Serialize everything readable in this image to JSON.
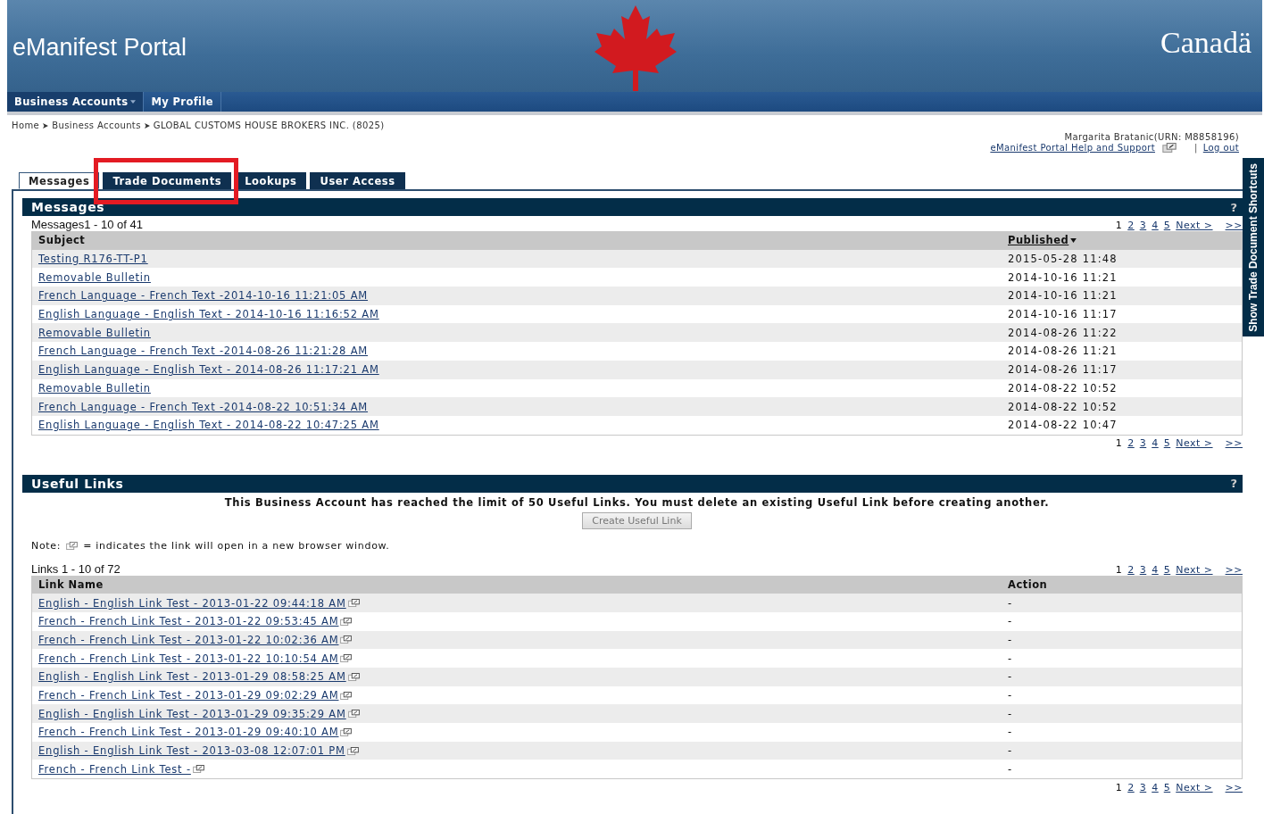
{
  "header": {
    "title": "eManifest Portal",
    "wordmark": "Canadä"
  },
  "nav": [
    {
      "label": "Business Accounts",
      "selected": true,
      "dropdown": true
    },
    {
      "label": "My Profile",
      "selected": false,
      "dropdown": false
    }
  ],
  "breadcrumb": [
    "Home",
    "Business Accounts",
    "GLOBAL CUSTOMS HOUSE BROKERS INC. (8025)"
  ],
  "user": {
    "name": "Margarita Bratanic(URN: M8858196)",
    "help_link": "eManifest Portal Help and Support",
    "separator": "|",
    "logout": "Log out"
  },
  "tabs": [
    {
      "label": "Messages",
      "selected": true,
      "highlighted": false
    },
    {
      "label": "Trade Documents",
      "selected": false,
      "highlighted": true
    },
    {
      "label": "Lookups",
      "selected": false,
      "highlighted": false
    },
    {
      "label": "User Access",
      "selected": false,
      "highlighted": false
    }
  ],
  "side_tab": "Show Trade Document Shortcuts",
  "messages": {
    "title": "Messages",
    "help": "?",
    "count": "Messages1 - 10 of 41",
    "pager_top": {
      "pages": [
        {
          "label": "1",
          "selected": true
        },
        {
          "label": "2",
          "selected": false
        },
        {
          "label": "3",
          "selected": false
        },
        {
          "label": "4",
          "selected": false
        },
        {
          "label": "5",
          "selected": false
        }
      ],
      "next": "Next >",
      "last": ">>"
    },
    "columns": [
      {
        "label": "Subject",
        "sorted": false
      },
      {
        "label": "Published",
        "sorted": true
      }
    ],
    "rows": [
      {
        "subject": "Testing R176-TT-P1",
        "published": "2015-05-28 11:48"
      },
      {
        "subject": "Removable Bulletin",
        "published": "2014-10-16 11:21"
      },
      {
        "subject": "French Language - French Text -2014-10-16 11:21:05 AM",
        "published": "2014-10-16 11:21"
      },
      {
        "subject": "English Language - English Text - 2014-10-16 11:16:52 AM",
        "published": "2014-10-16 11:17"
      },
      {
        "subject": "Removable Bulletin",
        "published": "2014-08-26 11:22"
      },
      {
        "subject": "French Language - French Text -2014-08-26 11:21:28 AM",
        "published": "2014-08-26 11:21"
      },
      {
        "subject": "English Language - English Text - 2014-08-26 11:17:21 AM",
        "published": "2014-08-26 11:17"
      },
      {
        "subject": "Removable Bulletin",
        "published": "2014-08-22 10:52"
      },
      {
        "subject": "French Language - French Text -2014-08-22 10:51:34 AM",
        "published": "2014-08-22 10:52"
      },
      {
        "subject": "English Language - English Text - 2014-08-22 10:47:25 AM",
        "published": "2014-08-22 10:47"
      }
    ],
    "pager_bottom": {
      "pages": [
        {
          "label": "1",
          "selected": true
        },
        {
          "label": "2",
          "selected": false
        },
        {
          "label": "3",
          "selected": false
        },
        {
          "label": "4",
          "selected": false
        },
        {
          "label": "5",
          "selected": false
        }
      ],
      "next": "Next >",
      "last": ">>"
    }
  },
  "useful_links": {
    "title": "Useful Links",
    "help": "?",
    "notice": "This Business Account has reached the limit of 50 Useful Links. You must delete an existing Useful Link before creating another.",
    "create_button": {
      "label": "Create Useful Link",
      "disabled": true
    },
    "note_prefix": "Note:",
    "note_text": "= indicates the link will open in a new browser window.",
    "count": "Links 1 - 10 of 72",
    "pager_top": {
      "pages": [
        {
          "label": "1",
          "selected": true
        },
        {
          "label": "2",
          "selected": false
        },
        {
          "label": "3",
          "selected": false
        },
        {
          "label": "4",
          "selected": false
        },
        {
          "label": "5",
          "selected": false
        }
      ],
      "next": "Next >",
      "last": ">>"
    },
    "columns": [
      {
        "label": "Link Name",
        "sorted": false
      },
      {
        "label": "Action",
        "sorted": false
      }
    ],
    "rows": [
      {
        "name": "English - English Link Test - 2013-01-22 09:44:18 AM",
        "action": "-"
      },
      {
        "name": "French - French Link Test - 2013-01-22 09:53:45 AM",
        "action": "-"
      },
      {
        "name": "French - French Link Test - 2013-01-22 10:02:36 AM",
        "action": "-"
      },
      {
        "name": "French - French Link Test - 2013-01-22 10:10:54 AM",
        "action": "-"
      },
      {
        "name": "English - English Link Test - 2013-01-29 08:58:25 AM",
        "action": "-"
      },
      {
        "name": "French - French Link Test - 2013-01-29 09:02:29 AM",
        "action": "-"
      },
      {
        "name": "English - English Link Test - 2013-01-29 09:35:29 AM",
        "action": "-"
      },
      {
        "name": "French - French Link Test - 2013-01-29 09:40:10 AM",
        "action": "-"
      },
      {
        "name": "English - English Link Test - 2013-03-08 12:07:01 PM",
        "action": "-"
      },
      {
        "name": "French - French Link Test -",
        "action": "-"
      }
    ],
    "pager_bottom": {
      "pages": [
        {
          "label": "1",
          "selected": true
        },
        {
          "label": "2",
          "selected": false
        },
        {
          "label": "3",
          "selected": false
        },
        {
          "label": "4",
          "selected": false
        },
        {
          "label": "5",
          "selected": false
        }
      ],
      "next": "Next >",
      "last": ">>"
    }
  }
}
